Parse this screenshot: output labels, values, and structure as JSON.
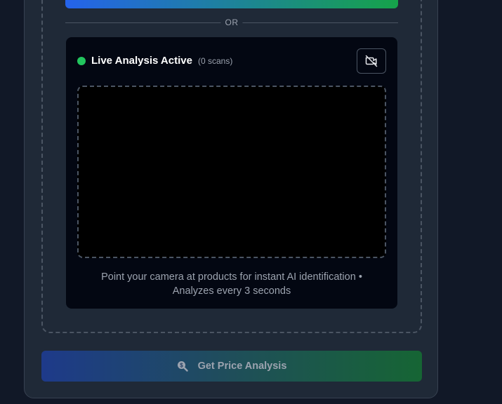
{
  "divider": {
    "or_text": "OR"
  },
  "live": {
    "title": "Live Analysis Active",
    "scan_count": "(0 scans)",
    "status_color": "#22c55e",
    "toggle_icon": "camera-off-icon",
    "hint_line1": "Point your camera at products for instant AI identification •",
    "hint_line2": "Analyzes every 3 seconds"
  },
  "actions": {
    "price_button_label": "Get Price Analysis",
    "price_button_icon": "search-dollar-icon"
  },
  "colors": {
    "background": "#111827",
    "card": "#1f2937",
    "panel": "#030712",
    "gradient_start": "#2563eb",
    "gradient_end": "#16a34a"
  }
}
